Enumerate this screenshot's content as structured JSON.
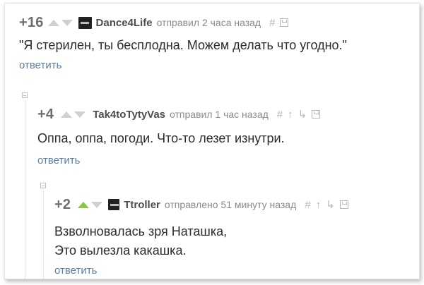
{
  "comments": [
    {
      "rating": "+16",
      "author": "Dance4Life",
      "meta": "отправил 2 часа назад",
      "text_lines": [
        "\"Я стерилен, ты бесплодна. Можем делать что угодно.\""
      ],
      "reply": "ответить",
      "icons": [
        "hash-icon",
        "save-icon"
      ]
    },
    {
      "rating": "+4",
      "author": "Tak4toTytyVas",
      "meta": "отправил 1 час назад",
      "text_lines": [
        "Оппа, оппа, погоди. Что-то лезет изнутри."
      ],
      "reply": "ответить",
      "icons": [
        "hash-icon",
        "parent-arrow-icon",
        "reply-branch-icon",
        "save-icon"
      ]
    },
    {
      "rating": "+2",
      "author": "Ttroller",
      "meta": "отправлено 51 минуту назад",
      "text_lines": [
        "Взволновалась зря Наташка,",
        "Это вылезла какашка."
      ],
      "reply": "ответить",
      "upvoted": true,
      "icons": [
        "hash-icon",
        "parent-arrow-icon",
        "reply-branch-icon",
        "save-icon"
      ]
    }
  ],
  "glyphs": {
    "hash": "#",
    "parent": "↑",
    "branch": "↳"
  },
  "colors": {
    "upvote_active": "#8cc63e",
    "reply_link": "#5a7fa8",
    "rating": "#6f6f6f"
  }
}
